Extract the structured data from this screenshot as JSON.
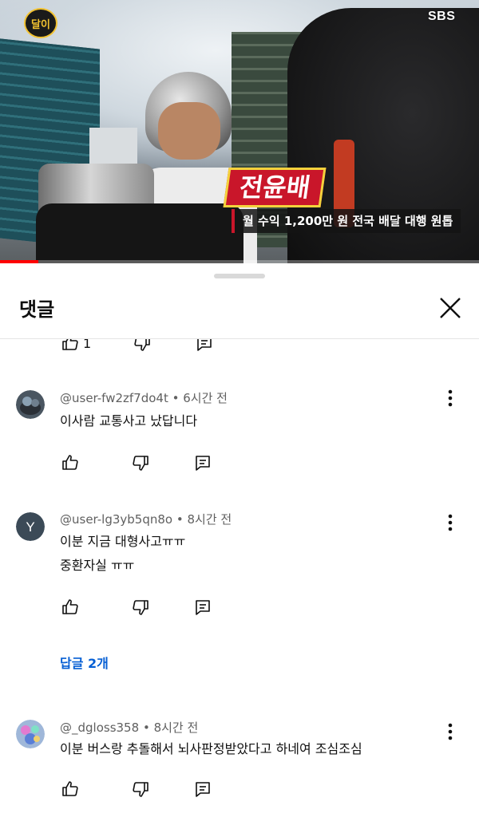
{
  "video": {
    "show_logo_text": "달이",
    "channel_watermark": "SBS",
    "caption_name": "전윤배",
    "caption_sub": "월 수익 1,200만 원 전국 배달 대행 원톱",
    "progress_fraction": 0.08
  },
  "sheet": {
    "title": "댓글"
  },
  "top_actions": {
    "like_count": "1"
  },
  "comments": [
    {
      "author": "@user-fw2zf7do4t",
      "time": "6시간 전",
      "lines": [
        "이사람 교통사고 났답니다"
      ],
      "avatar_type": "image"
    },
    {
      "author": "@user-lg3yb5qn8o",
      "time": "8시간 전",
      "lines": [
        "이분 지금 대형사고ㅠㅠ",
        "중환자실 ㅠㅠ"
      ],
      "avatar_letter": "Y",
      "replies_label": "답글 2개"
    },
    {
      "author": "@_dgloss358",
      "time": "8시간 전",
      "lines": [
        "이분 버스랑 추돌해서 뇌사판정받았다고 하네여 조심조심"
      ],
      "avatar_type": "image"
    }
  ],
  "meta_separator": "•",
  "colors": {
    "accent_red": "#ff0000",
    "link_blue": "#065fd4",
    "meta_gray": "#606060",
    "avatar_y_bg": "#3b4a57"
  }
}
